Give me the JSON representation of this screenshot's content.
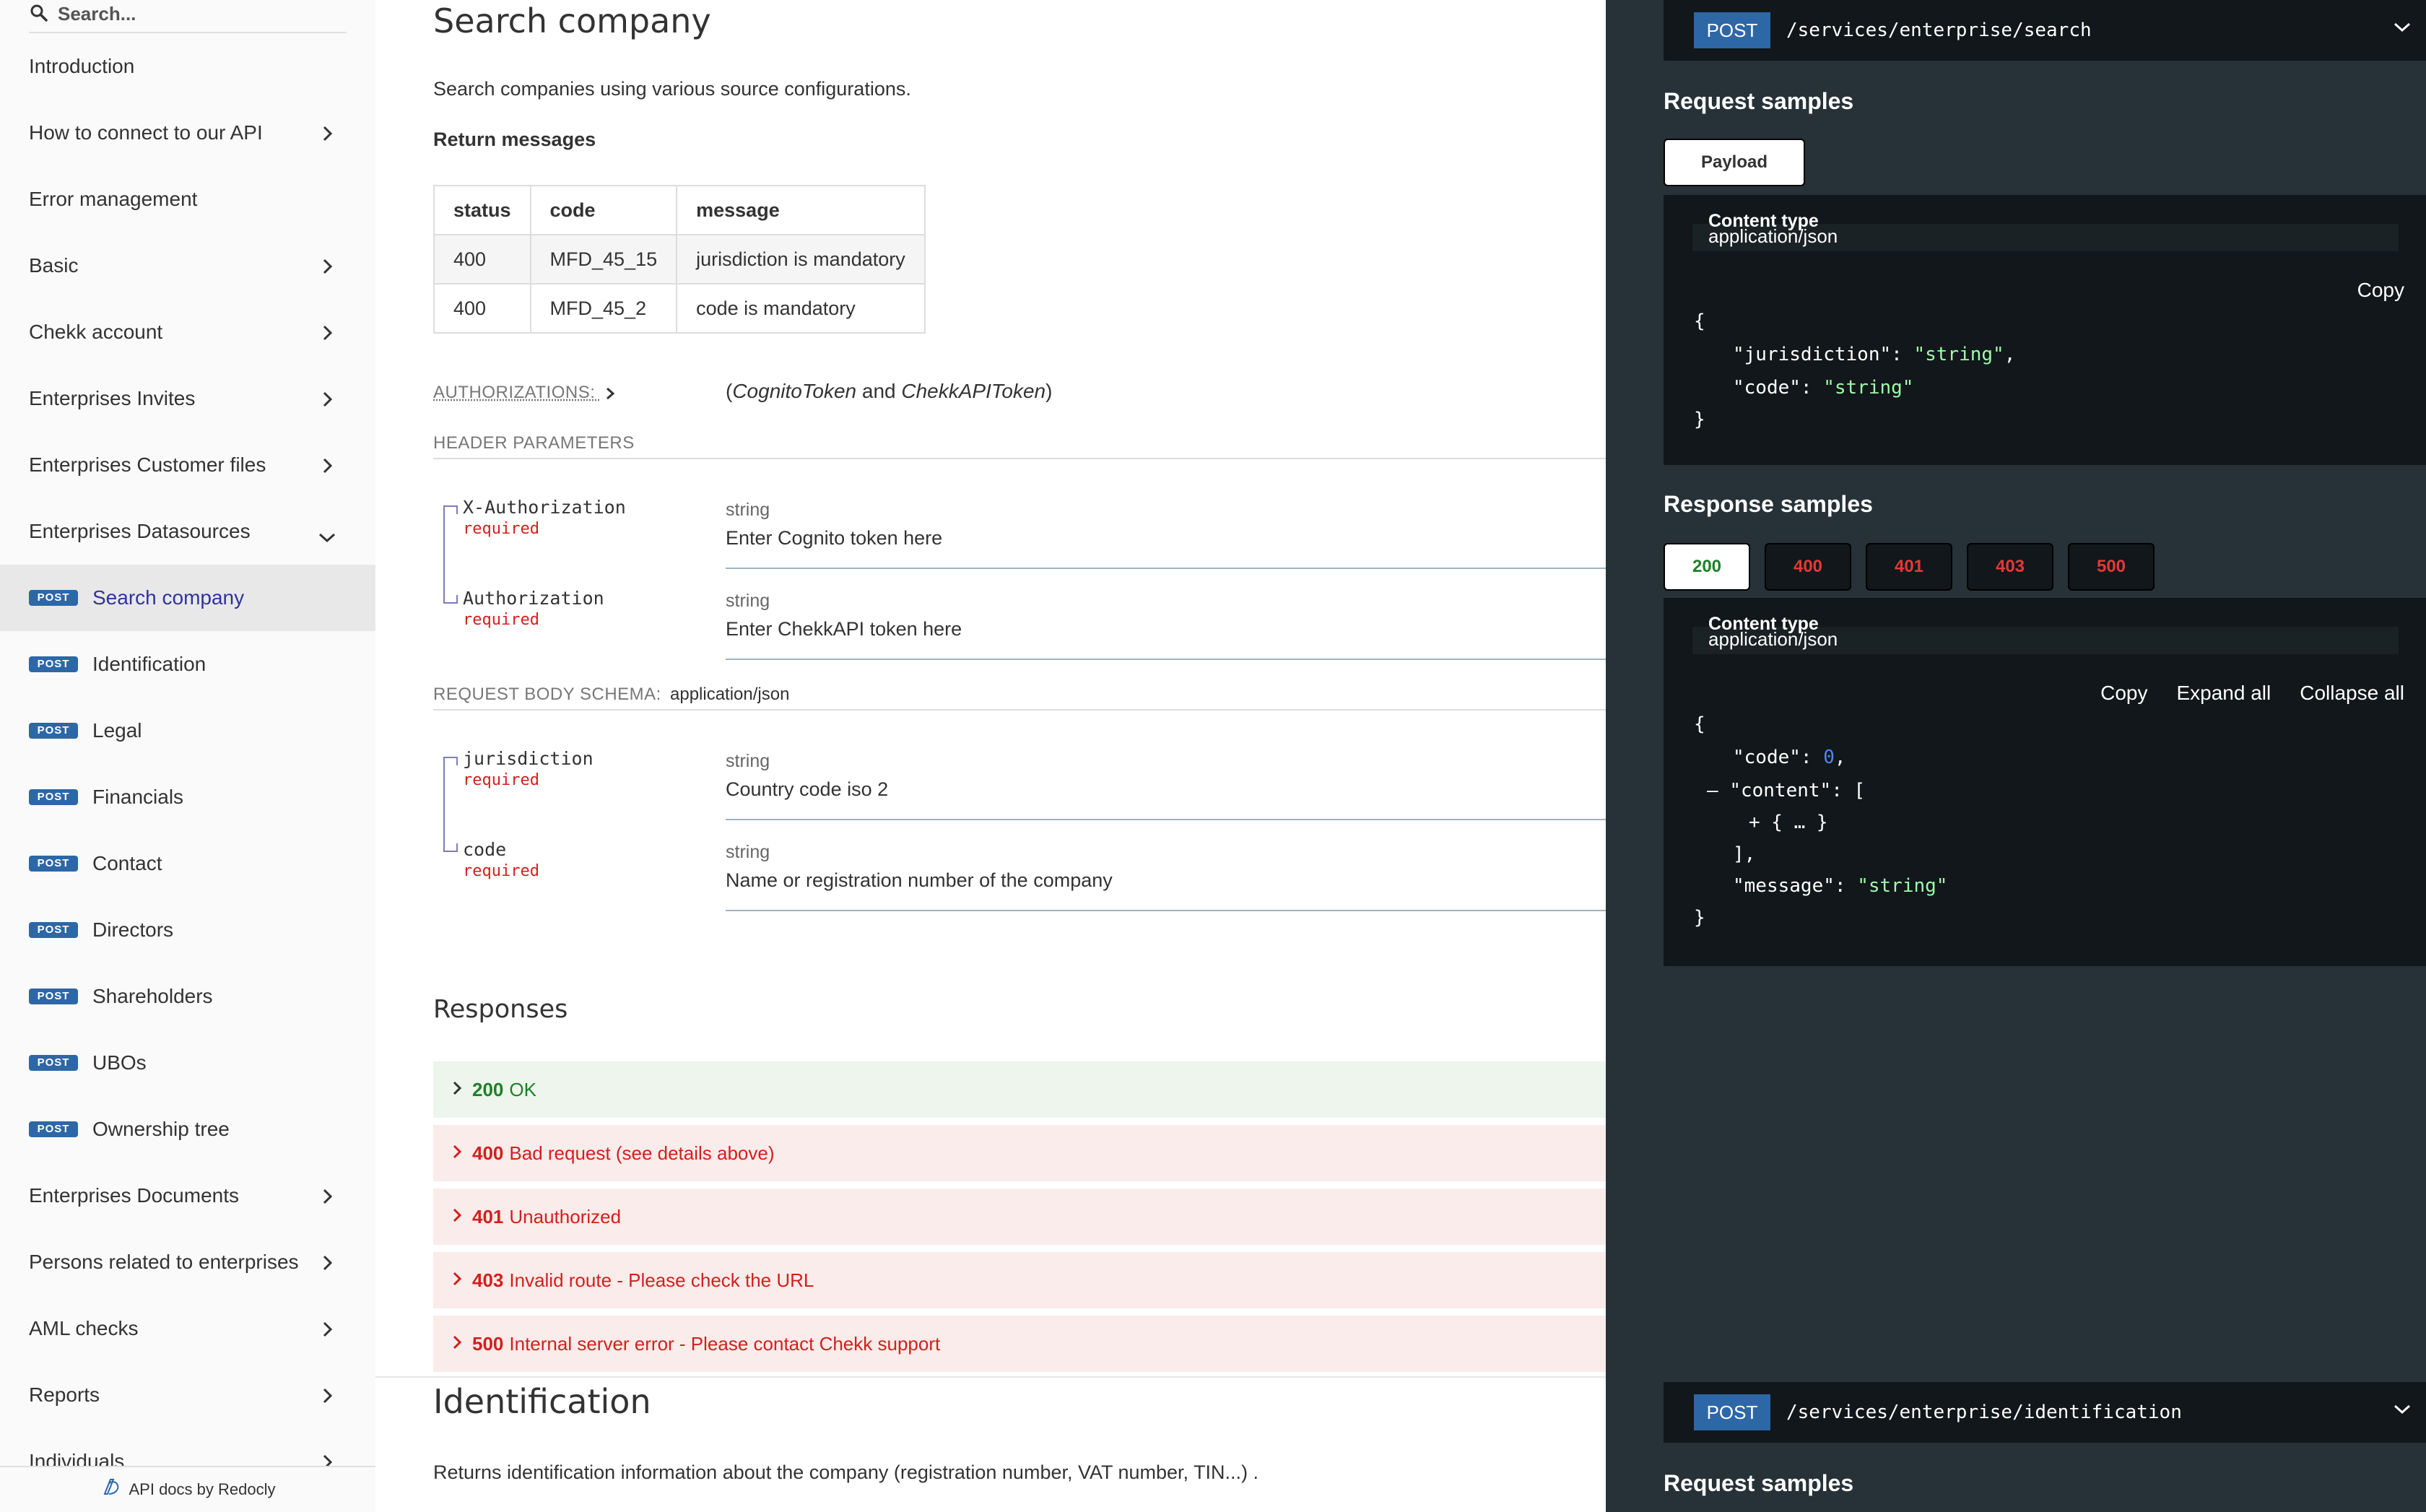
{
  "sidebar": {
    "search_placeholder": "Search...",
    "items": [
      {
        "label": "Introduction"
      },
      {
        "label": "How to connect to our API"
      },
      {
        "label": "Error management"
      },
      {
        "label": "Basic"
      },
      {
        "label": "Chekk account"
      },
      {
        "label": "Enterprises Invites"
      },
      {
        "label": "Enterprises Customer files"
      },
      {
        "label": "Enterprises Datasources"
      },
      {
        "label": "Search company",
        "badge": "POST"
      },
      {
        "label": "Identification",
        "badge": "POST"
      },
      {
        "label": "Legal",
        "badge": "POST"
      },
      {
        "label": "Financials",
        "badge": "POST"
      },
      {
        "label": "Contact",
        "badge": "POST"
      },
      {
        "label": "Directors",
        "badge": "POST"
      },
      {
        "label": "Shareholders",
        "badge": "POST"
      },
      {
        "label": "UBOs",
        "badge": "POST"
      },
      {
        "label": "Ownership tree",
        "badge": "POST"
      },
      {
        "label": "Enterprises Documents"
      },
      {
        "label": "Persons related to enterprises"
      },
      {
        "label": "AML checks"
      },
      {
        "label": "Reports"
      },
      {
        "label": "Individuals"
      }
    ],
    "footer": "API docs by Redocly"
  },
  "main": {
    "title": "Search company",
    "description": "Search companies using various source configurations.",
    "return_messages_title": "Return messages",
    "table": {
      "headers": [
        "status",
        "code",
        "message"
      ],
      "rows": [
        [
          "400",
          "MFD_45_15",
          "jurisdiction is mandatory"
        ],
        [
          "400",
          "MFD_45_2",
          "code is mandatory"
        ]
      ]
    },
    "authorizations_label": "AUTHORIZATIONS:",
    "auth_open": "(",
    "auth_token1": "CognitoToken",
    "auth_and": " and ",
    "auth_token2": "ChekkAPIToken",
    "auth_close": ")",
    "header_params_label": "HEADER PARAMETERS",
    "header_params": [
      {
        "name": "X-Authorization",
        "required": "required",
        "type": "string",
        "desc": "Enter Cognito token here"
      },
      {
        "name": "Authorization",
        "required": "required",
        "type": "string",
        "desc": "Enter ChekkAPI token here"
      }
    ],
    "body_schema_label": "REQUEST BODY SCHEMA:",
    "body_schema_type": "application/json",
    "body_params": [
      {
        "name": "jurisdiction",
        "required": "required",
        "type": "string",
        "desc": "Country code iso 2"
      },
      {
        "name": "code",
        "required": "required",
        "type": "string",
        "desc": "Name or registration number of the company"
      }
    ],
    "responses_title": "Responses",
    "responses": [
      {
        "code": "200",
        "text": "OK"
      },
      {
        "code": "400",
        "text": "Bad request (see details above)"
      },
      {
        "code": "401",
        "text": "Unauthorized"
      },
      {
        "code": "403",
        "text": "Invalid route - Please check the URL"
      },
      {
        "code": "500",
        "text": "Internal server error - Please contact Chekk support"
      }
    ],
    "next_title": "Identification",
    "next_description": "Returns identification information about the company (registration number, VAT number, TIN...) ."
  },
  "right": {
    "endpoint1": {
      "method": "POST",
      "path": "/services/enterprise/search"
    },
    "request_samples_title": "Request samples",
    "payload_tab": "Payload",
    "content_type_label": "Content type",
    "content_type_value": "application/json",
    "copy_label": "Copy",
    "request_code": {
      "open": "{",
      "k1": "\"jurisdiction\"",
      "v1": "\"string\"",
      "k2": "\"code\"",
      "v2": "\"string\"",
      "close": "}"
    },
    "response_samples_title": "Response samples",
    "response_tabs": [
      "200",
      "400",
      "401",
      "403",
      "500"
    ],
    "expand_all": "Expand all",
    "collapse_all": "Collapse all",
    "response_code": {
      "open": "{",
      "k_code": "\"code\"",
      "v_code": "0",
      "toggle": "–",
      "k_content": "\"content\"",
      "bracket_open": "[",
      "collapsed": "+ { … }",
      "bracket_close": "],",
      "k_message": "\"message\"",
      "v_message": "\"string\"",
      "close": "}"
    },
    "endpoint2": {
      "method": "POST",
      "path": "/services/enterprise/identification"
    },
    "request_samples_title2": "Request samples"
  },
  "colors": {
    "post_badge": "#2d67a6",
    "right_panel_bg": "#263238",
    "code_bg": "#11171a",
    "success": "#1d8127",
    "error": "#d41f1c"
  }
}
